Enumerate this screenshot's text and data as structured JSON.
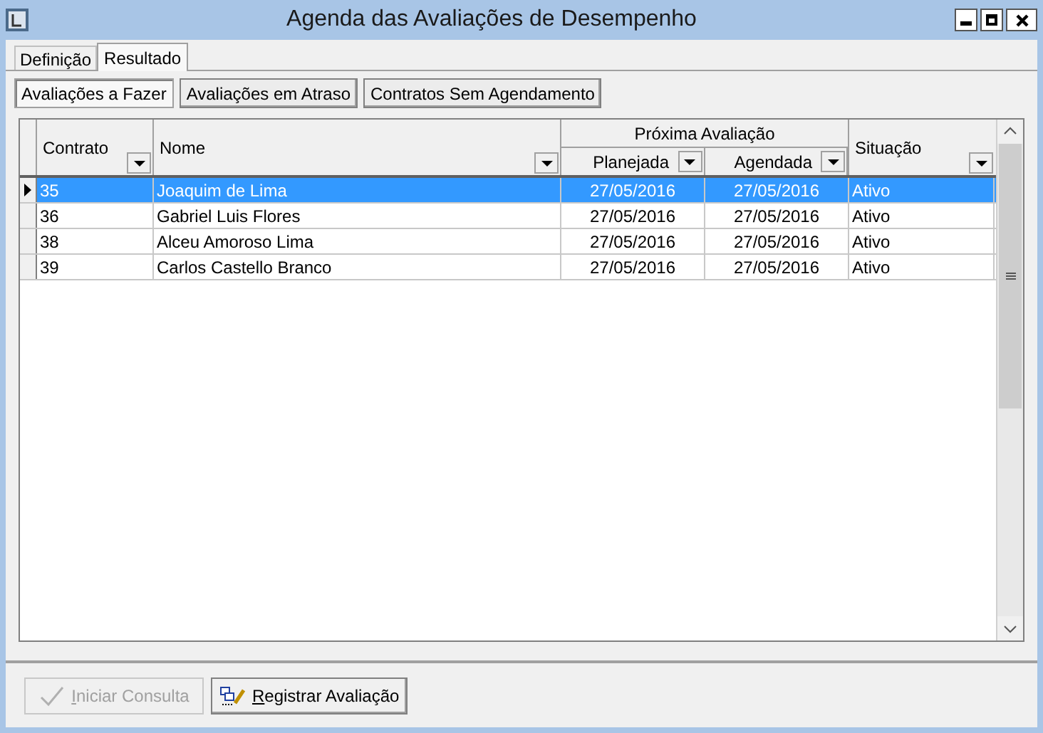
{
  "window": {
    "title": "Agenda das Avaliações de Desempenho"
  },
  "tabs": [
    {
      "label": "Definição",
      "selected": false
    },
    {
      "label": "Resultado",
      "selected": true
    }
  ],
  "views": [
    {
      "label": "Avaliações a Fazer",
      "selected": true
    },
    {
      "label": "Avaliações em Atraso",
      "selected": false
    },
    {
      "label": "Contratos Sem Agendamento",
      "selected": false
    }
  ],
  "table": {
    "group_header": "Próxima Avaliação",
    "columns": [
      {
        "label": "Contrato"
      },
      {
        "label": "Nome"
      },
      {
        "label": "Planejada"
      },
      {
        "label": "Agendada"
      },
      {
        "label": "Situação"
      }
    ],
    "rows": [
      {
        "cells": [
          "35",
          "Joaquim de Lima",
          "27/05/2016",
          "27/05/2016",
          "Ativo"
        ],
        "selected": true
      },
      {
        "cells": [
          "36",
          "Gabriel Luis Flores",
          "27/05/2016",
          "27/05/2016",
          "Ativo"
        ],
        "selected": false
      },
      {
        "cells": [
          "38",
          "Alceu Amoroso Lima",
          "27/05/2016",
          "27/05/2016",
          "Ativo"
        ],
        "selected": false
      },
      {
        "cells": [
          "39",
          "Carlos Castello Branco",
          "27/05/2016",
          "27/05/2016",
          "Ativo"
        ],
        "selected": false
      }
    ]
  },
  "buttons": [
    {
      "label": "Iniciar Consulta",
      "kind": "check",
      "disabled": true
    },
    {
      "label": "Registrar Avaliação",
      "kind": "edit",
      "disabled": false
    }
  ]
}
